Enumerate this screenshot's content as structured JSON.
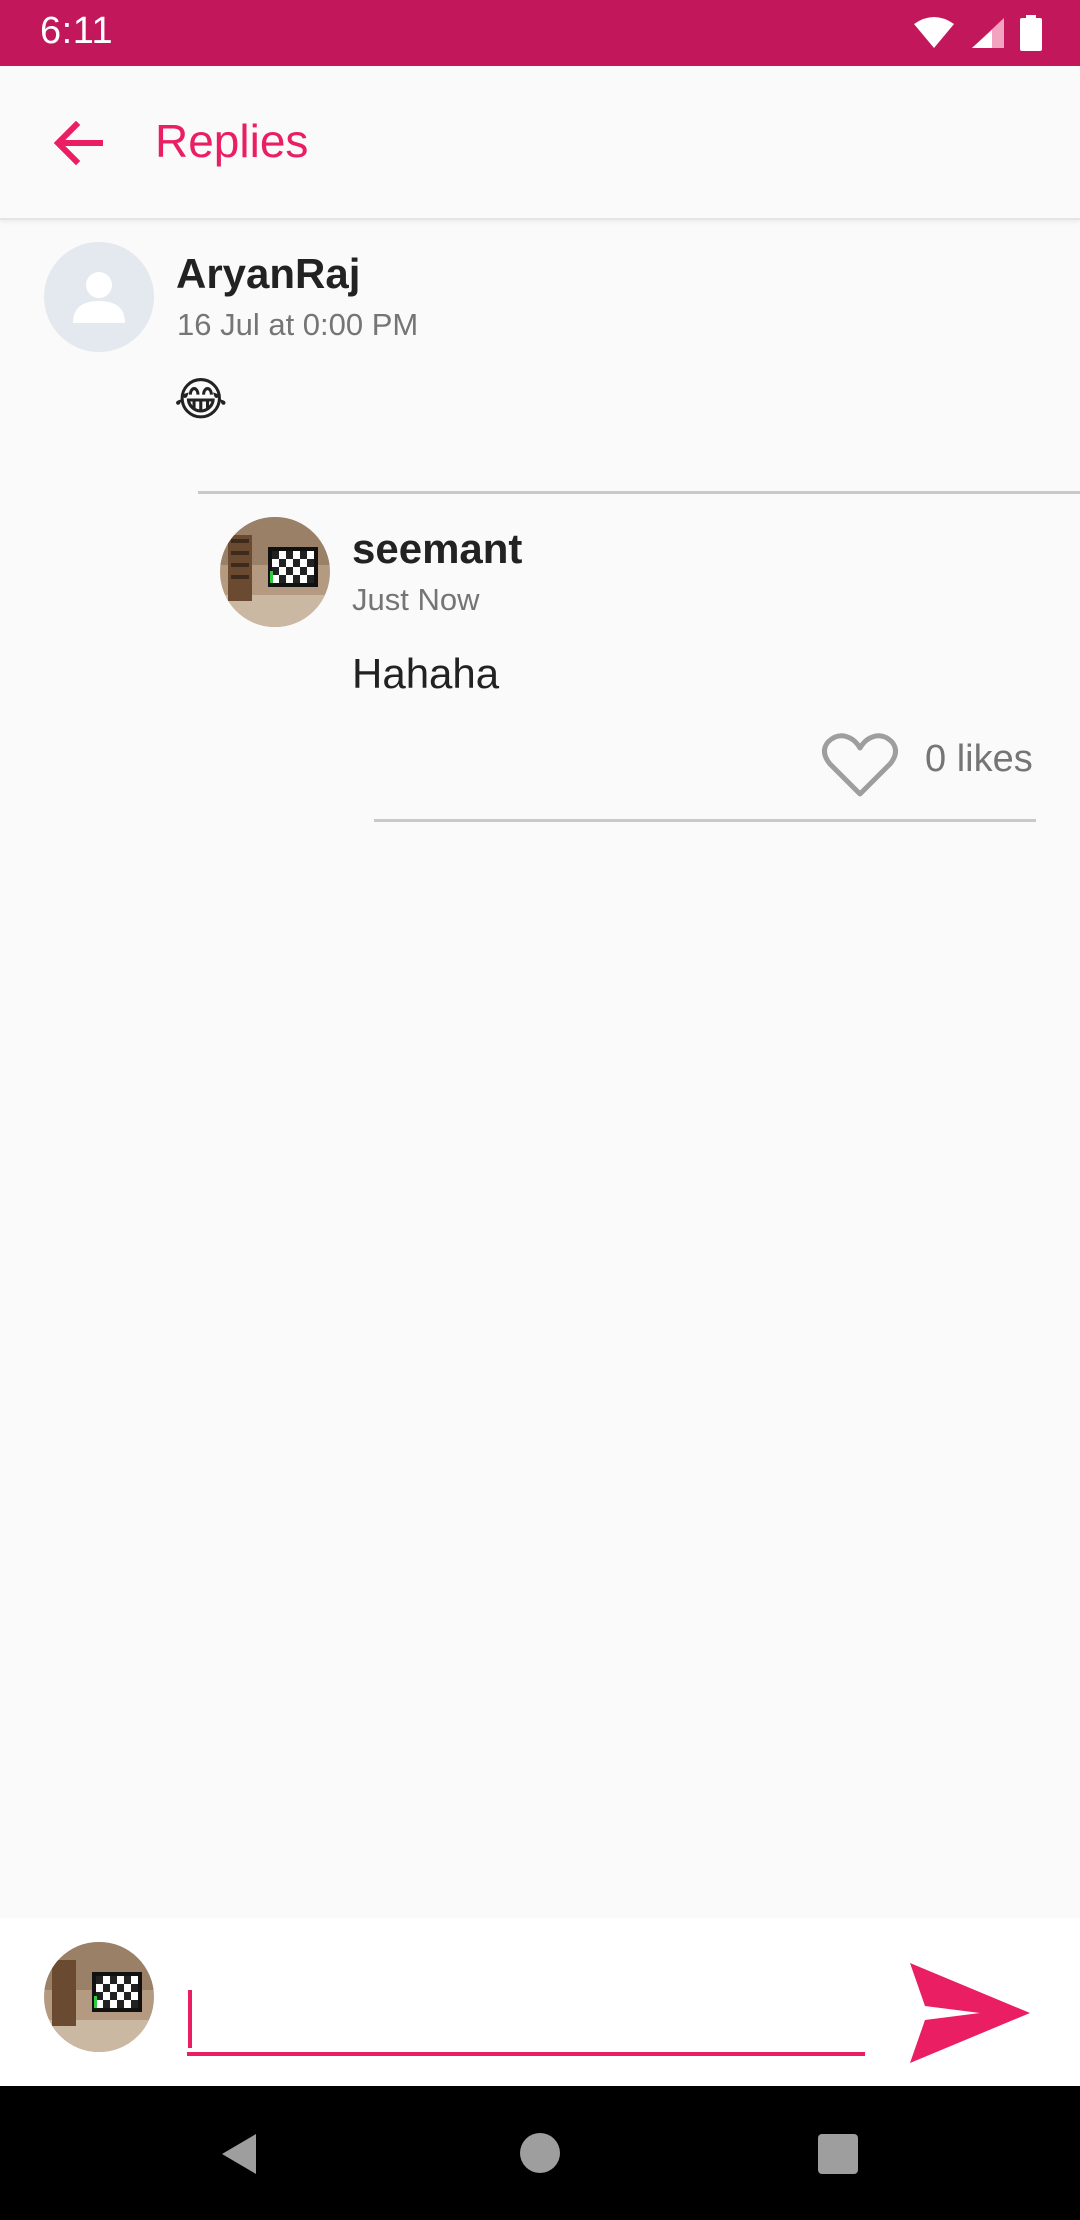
{
  "status_bar": {
    "time": "6:11",
    "icons": [
      "wifi-icon",
      "signal-icon",
      "battery-icon"
    ]
  },
  "app_bar": {
    "back_icon": "arrow-left-icon",
    "title": "Replies"
  },
  "parent_comment": {
    "author": "AryanRaj",
    "timestamp": "16 Jul at 0:00 PM",
    "text": "😂"
  },
  "replies": [
    {
      "author": "seemant",
      "timestamp": "Just Now",
      "text": "Hahaha",
      "likes_label": "0 likes",
      "like_icon": "heart-outline-icon"
    }
  ],
  "composer": {
    "placeholder": "",
    "value": "",
    "send_icon": "send-icon"
  },
  "colors": {
    "accent": "#e91e63",
    "status_bar": "#c2185b",
    "background": "#fafafa"
  }
}
